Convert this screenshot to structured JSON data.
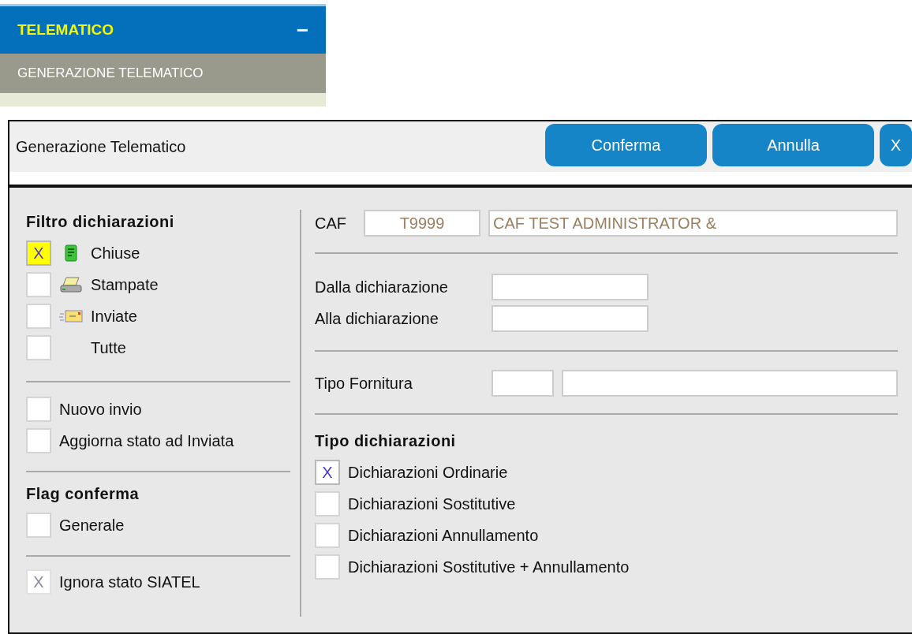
{
  "menu": {
    "title": "TELEMATICO",
    "collapse_glyph": "−",
    "items": [
      {
        "label": "GENERAZIONE TELEMATICO",
        "selected": true
      }
    ]
  },
  "dialog": {
    "title": "Generazione Telematico",
    "buttons": [
      {
        "label": "Conferma"
      },
      {
        "label": "Annulla"
      },
      {
        "label": "X"
      }
    ],
    "left": {
      "sections": [
        {
          "heading": "Filtro dichiarazioni",
          "items": [
            {
              "label": "Chiuse",
              "kind": "document",
              "checked": true,
              "mark": "X",
              "focused": true,
              "disabled": false
            },
            {
              "label": "Stampate",
              "kind": "printer",
              "checked": false,
              "focused": false,
              "disabled": false
            },
            {
              "label": "Inviate",
              "kind": "envelope",
              "checked": false,
              "focused": false,
              "disabled": false
            },
            {
              "label": "Tutte",
              "kind": "plain",
              "checked": false,
              "focused": false,
              "disabled": false
            }
          ]
        },
        {
          "items": [
            {
              "label": "Nuovo invio",
              "checked": false,
              "focused": false,
              "disabled": false
            },
            {
              "label": "Aggiorna stato ad Inviata",
              "checked": false,
              "focused": false,
              "disabled": false
            }
          ]
        },
        {
          "heading": "Flag conferma",
          "items": [
            {
              "label": "Generale",
              "checked": false,
              "focused": false,
              "disabled": false
            }
          ]
        },
        {
          "items": [
            {
              "label": "Ignora stato SIATEL",
              "checked": true,
              "mark": "X",
              "focused": false,
              "disabled": true
            }
          ]
        }
      ]
    },
    "caf": {
      "label": "CAF",
      "code": "T9999",
      "name": "CAF TEST ADMINISTRATOR &"
    },
    "range": [
      {
        "label": "Dalla dichiarazione"
      },
      {
        "label": "Alla dichiarazione"
      }
    ],
    "tipo_fornitura": {
      "label": "Tipo Fornitura"
    },
    "tipo_dichiarazioni": {
      "heading": "Tipo dichiarazioni",
      "items": [
        {
          "label": "Dichiarazioni Ordinarie",
          "checked": true,
          "mark": "X"
        },
        {
          "label": "Dichiarazioni Sostitutive",
          "checked": false
        },
        {
          "label": "Dichiarazioni Annullamento",
          "checked": false
        },
        {
          "label": "Dichiarazioni Sostitutive + Annullamento",
          "checked": false
        }
      ]
    }
  }
}
